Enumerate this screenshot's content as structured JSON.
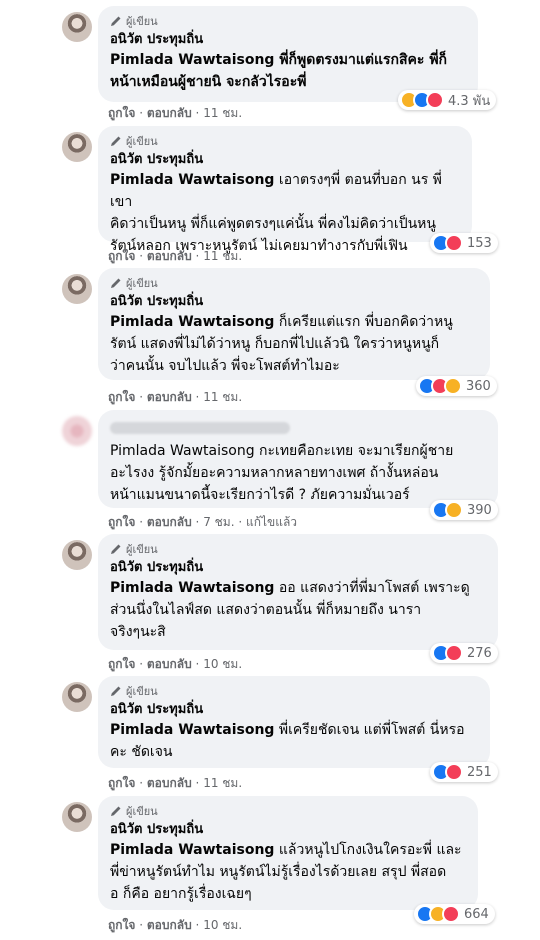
{
  "comments": [
    {
      "badge": "ผู้เขียน",
      "author": "อนิวัต ประทุมถิ่น",
      "tag": "",
      "lines": [
        "Pimlada Wawtaisong พี่ก็พูดตรงมาแต่แรกสิคะ พี่ก็",
        "หน้าเหมือนผู้ชายนิ จะกลัวไรอะพี่"
      ],
      "reactions_count": "4.3 พัน",
      "like": "ถูกใจ",
      "reply": "ตอบกลับ",
      "time": "11 ชม."
    },
    {
      "badge": "ผู้เขียน",
      "author": "อนิวัต ประทุมถิ่น",
      "tag": "Pimlada Wawtaisong",
      "lines": [
        " เอาตรงๆพี่ ตอนที่บอก นร พี่เขา",
        "คิดว่าเป็นหนู พี่ก็แค่พูดตรงๆแค่นั้น พี่คงไม่คิดว่าเป็นหนู",
        "รัตน์หลอก เพราะหนูรัตน์ ไม่เคยมาทำงารกับพี่เฟิน"
      ],
      "reactions_count": "153",
      "like": "ถูกใจ",
      "reply": "ตอบกลับ",
      "time": "11 ชม."
    },
    {
      "badge": "ผู้เขียน",
      "author": "อนิวัต ประทุมถิ่น",
      "tag": "Pimlada Wawtaisong",
      "lines": [
        " ก็เครียแต่แรก พี่บอกคิดว่าหนู",
        "รัตน์ แสดงพี่ไม่ได้ว่าหนู ก็บอกพี่ไปแล้วนิ ใครว่าหนูหนูก็",
        "ว่าคนนั้น จบไปแล้ว พี่จะโพสต์ทำไมอะ"
      ],
      "reactions_count": "360",
      "like": "ถูกใจ",
      "reply": "ตอบกลับ",
      "time": "11 ชม."
    },
    {
      "badge": "",
      "author": "",
      "tag": "",
      "lines": [
        "Pimlada Wawtaisong กะเทยคือกะเทย จะมาเรียกผู้ชาย",
        "อะไรงง รู้จักมั้ยอะความหลากหลายทางเพศ ถ้างั้นหล่อน",
        "หน้าแมนขนาดนี้จะเรียกว่าไรดี ? ภัยความมั่นเวอร์"
      ],
      "reactions_count": "390",
      "like": "ถูกใจ",
      "reply": "ตอบกลับ",
      "time": "7 ชม.",
      "edited": "แก้ไขแล้ว"
    },
    {
      "badge": "ผู้เขียน",
      "author": "อนิวัต ประทุมถิ่น",
      "tag": "Pimlada Wawtaisong",
      "lines": [
        " ออ แสดงว่าที่พี่มาโพสต์ เพราะดู",
        "ส่วนนึ่งในไลฟ์สด แสดงว่าตอนนั้น พี่ก็หมายถึง นารา",
        "จริงๆนะสิ"
      ],
      "reactions_count": "276",
      "like": "ถูกใจ",
      "reply": "ตอบกลับ",
      "time": "10 ชม."
    },
    {
      "badge": "ผู้เขียน",
      "author": "อนิวัต ประทุมถิ่น",
      "tag": "Pimlada Wawtaisong",
      "lines": [
        " พี่เครียชัดเจน แต่พี่โพสต์ นี่หรอ",
        "คะ ชัดเจน"
      ],
      "reactions_count": "251",
      "like": "ถูกใจ",
      "reply": "ตอบกลับ",
      "time": "11 ชม."
    },
    {
      "badge": "ผู้เขียน",
      "author": "อนิวัต ประทุมถิ่น",
      "tag": "Pimlada Wawtaisong",
      "lines": [
        " แล้วหนูไปโกงเงินใครอะพี่ และ",
        "พี่ข่าหนูรัตน์ทำไม หนูรัตน์ไม่รู้เรื่องไรด้วยเลย สรุป พี่สอด",
        "อ ก็คือ อยากรู้เรื่องเฉยๆ"
      ],
      "reactions_count": "664",
      "like": "ถูกใจ",
      "reply": "ตอบกลับ",
      "time": "10 ชม."
    }
  ],
  "colors": {
    "bubble": "#f0f2f5",
    "meta": "#65676b",
    "like": "#1877f2",
    "love": "#f33e58",
    "haha": "#f7b125"
  }
}
